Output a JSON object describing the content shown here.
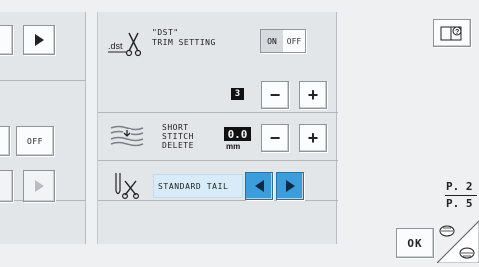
{
  "left": {
    "off_label": "OFF"
  },
  "dst": {
    "icon_text": ".dst",
    "title_line1": "\"DST\"",
    "title_line2": "TRIM SETTING",
    "on_label": "ON",
    "off_label": "OFF",
    "value_display": "3"
  },
  "short_stitch": {
    "line1": "SHORT",
    "line2": "STITCH",
    "line3": "DELETE",
    "value_display": "0.0",
    "unit": "mm"
  },
  "tail": {
    "label": "STANDARD TAIL"
  },
  "stepper": {
    "minus": "−",
    "plus": "+"
  },
  "pagination": {
    "current": "P. 2",
    "total": "P. 5"
  },
  "ok_label": "OK"
}
